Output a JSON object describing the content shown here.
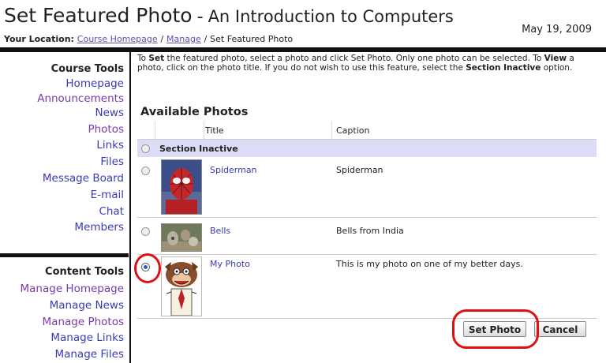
{
  "header": {
    "title": "Set Featured Photo",
    "separator": "-",
    "course": "An Introduction to Computers",
    "date": "May 19, 2009",
    "location_label": "Your Location:",
    "breadcrumb": [
      "Course Homepage",
      "Manage",
      "Set Featured Photo"
    ],
    "breadcrumb_sep": "/"
  },
  "sidebar": {
    "course_tools_title": "Course Tools",
    "course_tools": [
      "Homepage",
      "Announcements",
      "News",
      "Photos",
      "Links",
      "Files",
      "Message Board",
      "E-mail",
      "Chat",
      "Members"
    ],
    "content_tools_title": "Content Tools",
    "content_tools": [
      "Manage Homepage",
      "Manage News",
      "Manage Photos",
      "Manage Links",
      "Manage Files"
    ]
  },
  "main": {
    "intro_1_pre": "To ",
    "intro_1_bold": "Set",
    "intro_1_post": " the featured photo, select a photo and click Set Photo. Only one photo can be selected. To ",
    "intro_2_bold": "View",
    "intro_2_post": " a photo, click on the photo title. If you do not wish to use this feature, select the ",
    "intro_3_bold": "Section Inactive",
    "intro_3_post": " option.",
    "available_title": "Available Photos",
    "col_title": "Title",
    "col_caption": "Caption",
    "inactive_label": "Section Inactive",
    "photos": [
      {
        "title": "Spiderman",
        "caption": "Spiderman",
        "selected": false
      },
      {
        "title": "Bells",
        "caption": "Bells from India",
        "selected": false
      },
      {
        "title": "My Photo",
        "caption": "This is my photo on one of my better days.",
        "selected": true
      }
    ],
    "set_photo_label": "Set Photo",
    "cancel_label": "Cancel"
  },
  "colors": {
    "link": "#3a3ab8",
    "visited": "#7a3aa8",
    "highlight_row": "#dcdcf6",
    "annotation": "#e01010"
  }
}
